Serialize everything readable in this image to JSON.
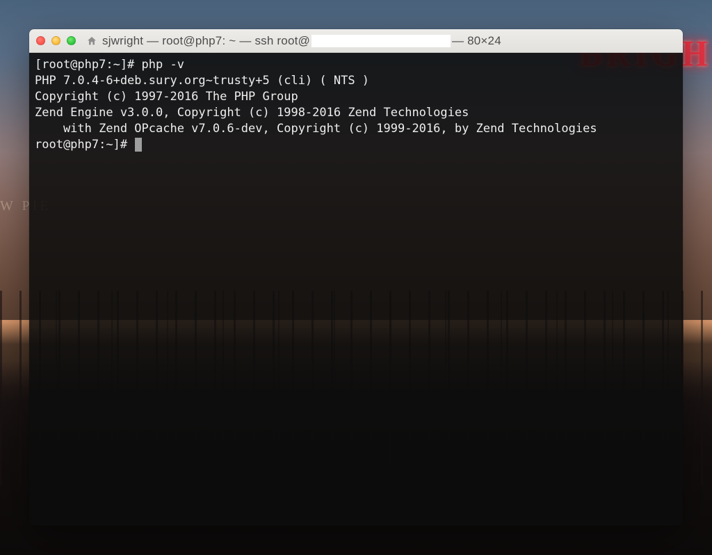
{
  "desktop": {
    "neon_text": "BRIGH",
    "arcade_text": "W PIE"
  },
  "window": {
    "title_prefix": "sjwright — root@php7: ~ — ssh root@",
    "title_suffix": "— 80×24"
  },
  "terminal": {
    "lines": [
      "[root@php7:~]# php -v",
      "PHP 7.0.4-6+deb.sury.org~trusty+5 (cli) ( NTS )",
      "Copyright (c) 1997-2016 The PHP Group",
      "Zend Engine v3.0.0, Copyright (c) 1998-2016 Zend Technologies",
      "    with Zend OPcache v7.0.6-dev, Copyright (c) 1999-2016, by Zend Technologies"
    ],
    "prompt": "root@php7:~]# "
  }
}
